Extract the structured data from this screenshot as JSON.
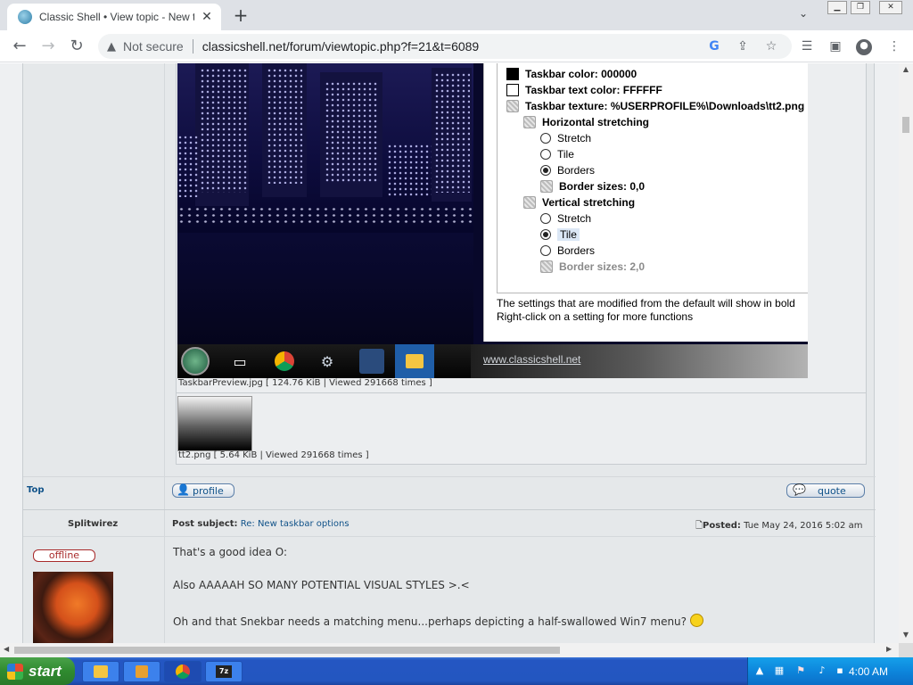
{
  "browser": {
    "tab_title": "Classic Shell • View topic - New t",
    "tab_close": "✕",
    "new_tab": "+",
    "security_label": "Not secure",
    "url": "classicshell.net/forum/viewtopic.php?f=21&t=6089"
  },
  "settings": {
    "rows": [
      {
        "type": "swatch",
        "color": "#000000",
        "label": "Taskbar color: 000000",
        "bold": true
      },
      {
        "type": "swatch",
        "color": "#FFFFFF",
        "label": "Taskbar text color: FFFFFF",
        "bold": true
      },
      {
        "type": "gear",
        "label": "Taskbar texture: %USERPROFILE%\\Downloads\\tt2.png",
        "bold": true
      },
      {
        "type": "gear",
        "label": "Horizontal stretching",
        "bold": true
      },
      {
        "type": "radio",
        "label": "Stretch",
        "checked": false
      },
      {
        "type": "radio",
        "label": "Tile",
        "checked": false
      },
      {
        "type": "radio",
        "label": "Borders",
        "checked": true
      },
      {
        "type": "gear",
        "label": "Border sizes: 0,0",
        "bold": true
      },
      {
        "type": "gear",
        "label": "Vertical stretching",
        "bold": true
      },
      {
        "type": "radio",
        "label": "Stretch",
        "checked": false
      },
      {
        "type": "radio",
        "label": "Tile",
        "checked": true,
        "selected": true
      },
      {
        "type": "radio",
        "label": "Borders",
        "checked": false
      },
      {
        "type": "gear",
        "label": "Border sizes: 2,0",
        "bold": true,
        "dim": true
      }
    ],
    "note_line1": "The settings that are modified from the default will show in bold",
    "note_line2": "Right-click on a setting for more functions"
  },
  "preview": {
    "taskbar_link": "www.classicshell.net"
  },
  "attachments": {
    "preview_caption": "TaskbarPreview.jpg [ 124.76 KiB | Viewed 291668 times ]",
    "thumb_caption": "tt2.png [ 5.64 KiB | Viewed 291668 times ]"
  },
  "post_footer": {
    "top_link": "Top",
    "profile_label": "profile",
    "quote_label": "quote"
  },
  "post": {
    "author": "Splitwirez",
    "subject_label": "Post subject:",
    "subject": "Re: New taskbar options",
    "posted_label": "Posted:",
    "posted_date": "Tue May 24, 2016 5:02 am",
    "status": "offline",
    "line1": "That's a good idea O:",
    "line2": "Also AAAAAH SO MANY POTENTIAL VISUAL STYLES >.<",
    "line3": "Oh and that Snekbar needs a matching menu...perhaps depicting a half-swallowed Win7 menu?"
  },
  "os_taskbar": {
    "start_label": "start",
    "clock": "4:00 AM"
  }
}
